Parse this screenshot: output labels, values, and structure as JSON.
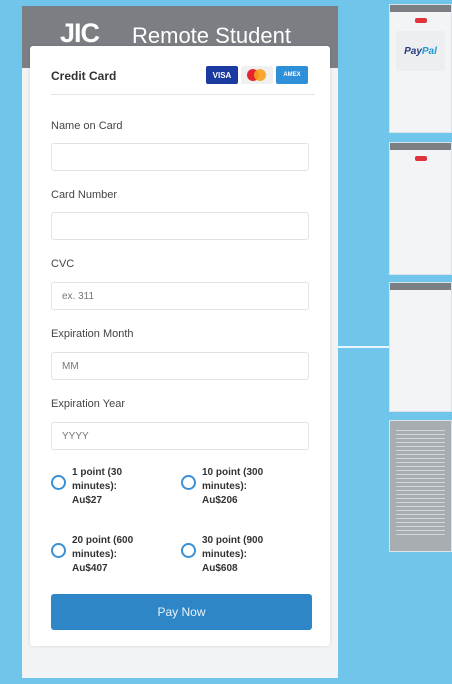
{
  "header": {
    "logo": "JIC",
    "title": "Remote Student"
  },
  "card": {
    "title": "Credit Card",
    "brands": [
      "VISA",
      "Mastercard",
      "AMERICAN EXPRESS"
    ]
  },
  "form": {
    "name": {
      "label": "Name on Card",
      "placeholder": ""
    },
    "number": {
      "label": "Card Number",
      "placeholder": ""
    },
    "cvc": {
      "label": "CVC",
      "placeholder": "ex. 311"
    },
    "month": {
      "label": "Expiration Month",
      "placeholder": "MM"
    },
    "year": {
      "label": "Expiration Year",
      "placeholder": "YYYY"
    }
  },
  "options": [
    {
      "line1": "1 point (30",
      "line2": "minutes):",
      "price": "Au$27"
    },
    {
      "line1": "10 point (300",
      "line2": "minutes):",
      "price": "Au$206"
    },
    {
      "line1": "20 point (600",
      "line2": "minutes):",
      "price": "Au$407"
    },
    {
      "line1": "30 point (900",
      "line2": "minutes):",
      "price": "Au$608"
    }
  ],
  "actions": {
    "pay": "Pay Now"
  },
  "thumbs": {
    "paypal1": "Pay",
    "paypal2": "Pal"
  }
}
